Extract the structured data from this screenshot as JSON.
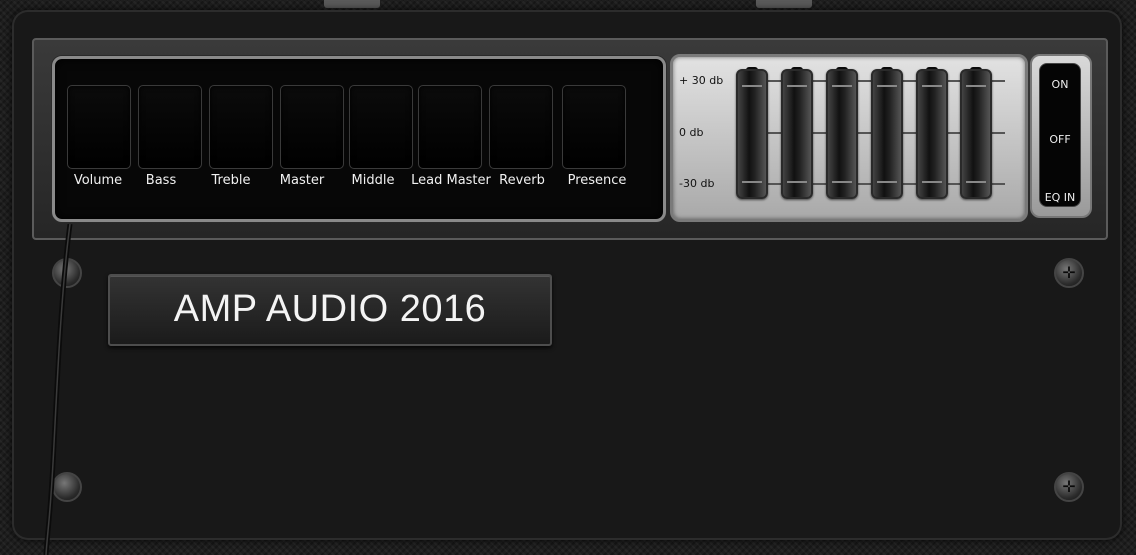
{
  "controls": {
    "knobs": [
      {
        "label": "Volume"
      },
      {
        "label": "Bass"
      },
      {
        "label": "Treble"
      },
      {
        "label": "Master"
      },
      {
        "label": "Middle"
      },
      {
        "label": "Lead Master"
      },
      {
        "label": "Reverb"
      },
      {
        "label": "Presence"
      }
    ]
  },
  "eq": {
    "labels": {
      "top": "+ 30 db",
      "mid": "0  db",
      "bottom": "-30 db"
    },
    "band_count": 6
  },
  "switch": {
    "on_label": "ON",
    "off_label": "OFF",
    "eq_in_label": "EQ  IN"
  },
  "brand": {
    "title": "AMP AUDIO 2016"
  },
  "icons": {
    "screw": "screw-icon",
    "cable": "cable-icon"
  }
}
